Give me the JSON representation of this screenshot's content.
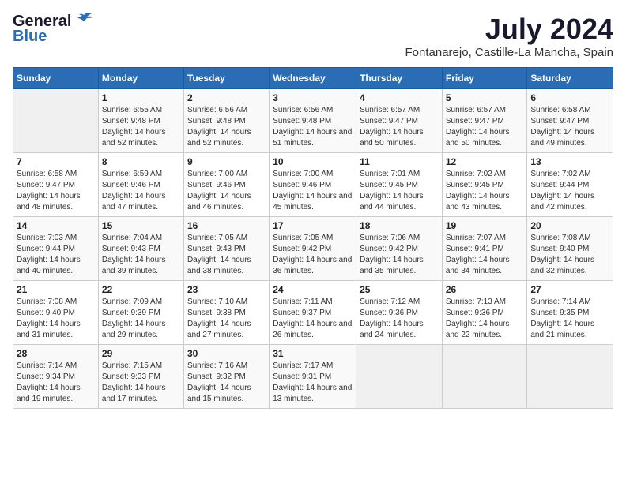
{
  "logo": {
    "general": "General",
    "blue": "Blue"
  },
  "title": {
    "month_year": "July 2024",
    "location": "Fontanarejo, Castille-La Mancha, Spain"
  },
  "header_days": [
    "Sunday",
    "Monday",
    "Tuesday",
    "Wednesday",
    "Thursday",
    "Friday",
    "Saturday"
  ],
  "weeks": [
    [
      {
        "day": "",
        "sunrise": "",
        "sunset": "",
        "daylight": ""
      },
      {
        "day": "1",
        "sunrise": "Sunrise: 6:55 AM",
        "sunset": "Sunset: 9:48 PM",
        "daylight": "Daylight: 14 hours and 52 minutes."
      },
      {
        "day": "2",
        "sunrise": "Sunrise: 6:56 AM",
        "sunset": "Sunset: 9:48 PM",
        "daylight": "Daylight: 14 hours and 52 minutes."
      },
      {
        "day": "3",
        "sunrise": "Sunrise: 6:56 AM",
        "sunset": "Sunset: 9:48 PM",
        "daylight": "Daylight: 14 hours and 51 minutes."
      },
      {
        "day": "4",
        "sunrise": "Sunrise: 6:57 AM",
        "sunset": "Sunset: 9:47 PM",
        "daylight": "Daylight: 14 hours and 50 minutes."
      },
      {
        "day": "5",
        "sunrise": "Sunrise: 6:57 AM",
        "sunset": "Sunset: 9:47 PM",
        "daylight": "Daylight: 14 hours and 50 minutes."
      },
      {
        "day": "6",
        "sunrise": "Sunrise: 6:58 AM",
        "sunset": "Sunset: 9:47 PM",
        "daylight": "Daylight: 14 hours and 49 minutes."
      }
    ],
    [
      {
        "day": "7",
        "sunrise": "Sunrise: 6:58 AM",
        "sunset": "Sunset: 9:47 PM",
        "daylight": "Daylight: 14 hours and 48 minutes."
      },
      {
        "day": "8",
        "sunrise": "Sunrise: 6:59 AM",
        "sunset": "Sunset: 9:46 PM",
        "daylight": "Daylight: 14 hours and 47 minutes."
      },
      {
        "day": "9",
        "sunrise": "Sunrise: 7:00 AM",
        "sunset": "Sunset: 9:46 PM",
        "daylight": "Daylight: 14 hours and 46 minutes."
      },
      {
        "day": "10",
        "sunrise": "Sunrise: 7:00 AM",
        "sunset": "Sunset: 9:46 PM",
        "daylight": "Daylight: 14 hours and 45 minutes."
      },
      {
        "day": "11",
        "sunrise": "Sunrise: 7:01 AM",
        "sunset": "Sunset: 9:45 PM",
        "daylight": "Daylight: 14 hours and 44 minutes."
      },
      {
        "day": "12",
        "sunrise": "Sunrise: 7:02 AM",
        "sunset": "Sunset: 9:45 PM",
        "daylight": "Daylight: 14 hours and 43 minutes."
      },
      {
        "day": "13",
        "sunrise": "Sunrise: 7:02 AM",
        "sunset": "Sunset: 9:44 PM",
        "daylight": "Daylight: 14 hours and 42 minutes."
      }
    ],
    [
      {
        "day": "14",
        "sunrise": "Sunrise: 7:03 AM",
        "sunset": "Sunset: 9:44 PM",
        "daylight": "Daylight: 14 hours and 40 minutes."
      },
      {
        "day": "15",
        "sunrise": "Sunrise: 7:04 AM",
        "sunset": "Sunset: 9:43 PM",
        "daylight": "Daylight: 14 hours and 39 minutes."
      },
      {
        "day": "16",
        "sunrise": "Sunrise: 7:05 AM",
        "sunset": "Sunset: 9:43 PM",
        "daylight": "Daylight: 14 hours and 38 minutes."
      },
      {
        "day": "17",
        "sunrise": "Sunrise: 7:05 AM",
        "sunset": "Sunset: 9:42 PM",
        "daylight": "Daylight: 14 hours and 36 minutes."
      },
      {
        "day": "18",
        "sunrise": "Sunrise: 7:06 AM",
        "sunset": "Sunset: 9:42 PM",
        "daylight": "Daylight: 14 hours and 35 minutes."
      },
      {
        "day": "19",
        "sunrise": "Sunrise: 7:07 AM",
        "sunset": "Sunset: 9:41 PM",
        "daylight": "Daylight: 14 hours and 34 minutes."
      },
      {
        "day": "20",
        "sunrise": "Sunrise: 7:08 AM",
        "sunset": "Sunset: 9:40 PM",
        "daylight": "Daylight: 14 hours and 32 minutes."
      }
    ],
    [
      {
        "day": "21",
        "sunrise": "Sunrise: 7:08 AM",
        "sunset": "Sunset: 9:40 PM",
        "daylight": "Daylight: 14 hours and 31 minutes."
      },
      {
        "day": "22",
        "sunrise": "Sunrise: 7:09 AM",
        "sunset": "Sunset: 9:39 PM",
        "daylight": "Daylight: 14 hours and 29 minutes."
      },
      {
        "day": "23",
        "sunrise": "Sunrise: 7:10 AM",
        "sunset": "Sunset: 9:38 PM",
        "daylight": "Daylight: 14 hours and 27 minutes."
      },
      {
        "day": "24",
        "sunrise": "Sunrise: 7:11 AM",
        "sunset": "Sunset: 9:37 PM",
        "daylight": "Daylight: 14 hours and 26 minutes."
      },
      {
        "day": "25",
        "sunrise": "Sunrise: 7:12 AM",
        "sunset": "Sunset: 9:36 PM",
        "daylight": "Daylight: 14 hours and 24 minutes."
      },
      {
        "day": "26",
        "sunrise": "Sunrise: 7:13 AM",
        "sunset": "Sunset: 9:36 PM",
        "daylight": "Daylight: 14 hours and 22 minutes."
      },
      {
        "day": "27",
        "sunrise": "Sunrise: 7:14 AM",
        "sunset": "Sunset: 9:35 PM",
        "daylight": "Daylight: 14 hours and 21 minutes."
      }
    ],
    [
      {
        "day": "28",
        "sunrise": "Sunrise: 7:14 AM",
        "sunset": "Sunset: 9:34 PM",
        "daylight": "Daylight: 14 hours and 19 minutes."
      },
      {
        "day": "29",
        "sunrise": "Sunrise: 7:15 AM",
        "sunset": "Sunset: 9:33 PM",
        "daylight": "Daylight: 14 hours and 17 minutes."
      },
      {
        "day": "30",
        "sunrise": "Sunrise: 7:16 AM",
        "sunset": "Sunset: 9:32 PM",
        "daylight": "Daylight: 14 hours and 15 minutes."
      },
      {
        "day": "31",
        "sunrise": "Sunrise: 7:17 AM",
        "sunset": "Sunset: 9:31 PM",
        "daylight": "Daylight: 14 hours and 13 minutes."
      },
      {
        "day": "",
        "sunrise": "",
        "sunset": "",
        "daylight": ""
      },
      {
        "day": "",
        "sunrise": "",
        "sunset": "",
        "daylight": ""
      },
      {
        "day": "",
        "sunrise": "",
        "sunset": "",
        "daylight": ""
      }
    ]
  ]
}
